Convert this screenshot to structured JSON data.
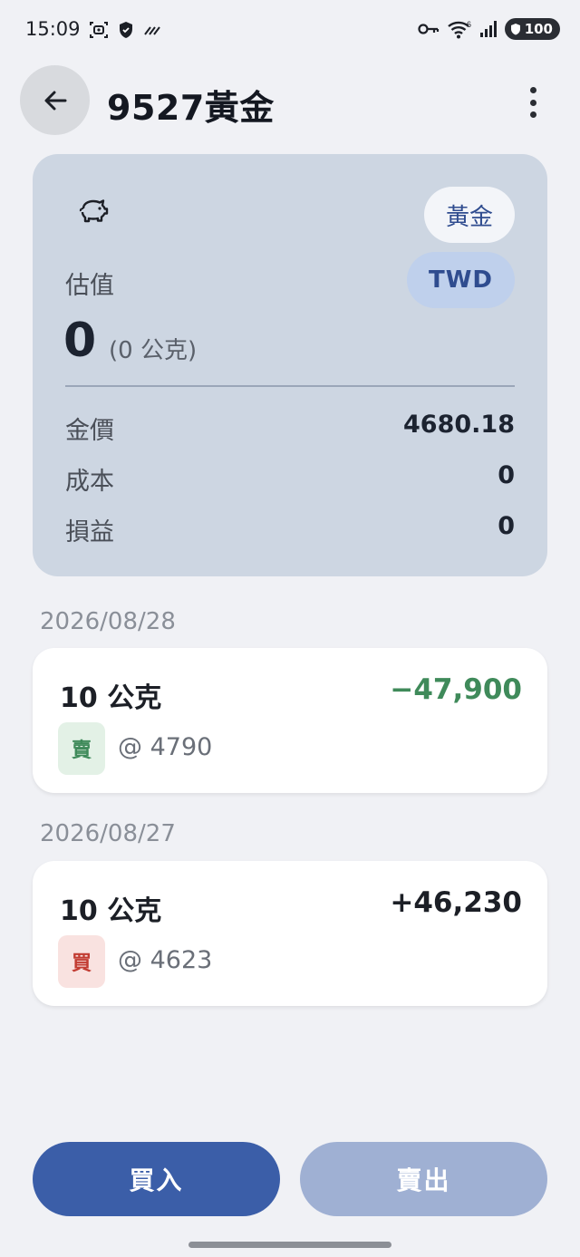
{
  "status_bar": {
    "time": "15:09",
    "battery": "100",
    "icons": [
      "screenshot-icon",
      "shield-icon",
      "no-signal-icon",
      "vpn-key-icon",
      "wifi-icon",
      "cell-signal-icon"
    ]
  },
  "header": {
    "title": "9527黃金",
    "back_icon": "arrow-back-icon",
    "more_icon": "more-vert-icon"
  },
  "summary": {
    "icon": "piggy-bank-icon",
    "asset_chip": "黃金",
    "currency_chip": "TWD",
    "estimate_label": "估值",
    "estimate_value": "0",
    "estimate_grams": "(0 公克)",
    "rows": [
      {
        "label": "金價",
        "value": "4680.18"
      },
      {
        "label": "成本",
        "value": "0"
      },
      {
        "label": "損益",
        "value": "0"
      }
    ]
  },
  "transactions": [
    {
      "date": "2026/08/28",
      "quantity": "10 公克",
      "amount": "−47,900",
      "type": "賣",
      "price": "@ 4790",
      "amount_color": "#3f8a5a",
      "badge_bg": "#e3f1e6",
      "badge_color": "#3f8a5a"
    },
    {
      "date": "2026/08/27",
      "quantity": "10 公克",
      "amount": "+46,230",
      "type": "買",
      "price": "@ 4623",
      "amount_color": "#1c1f26",
      "badge_bg": "#f9e2e0",
      "badge_color": "#c23c32"
    }
  ],
  "actions": {
    "buy_label": "買入",
    "sell_label": "賣出"
  },
  "colors": {
    "primary": "#3b5ea8",
    "primary_disabled": "#9fb0d3",
    "card_bg": "#cdd6e2",
    "page_bg": "#f0f1f5"
  }
}
